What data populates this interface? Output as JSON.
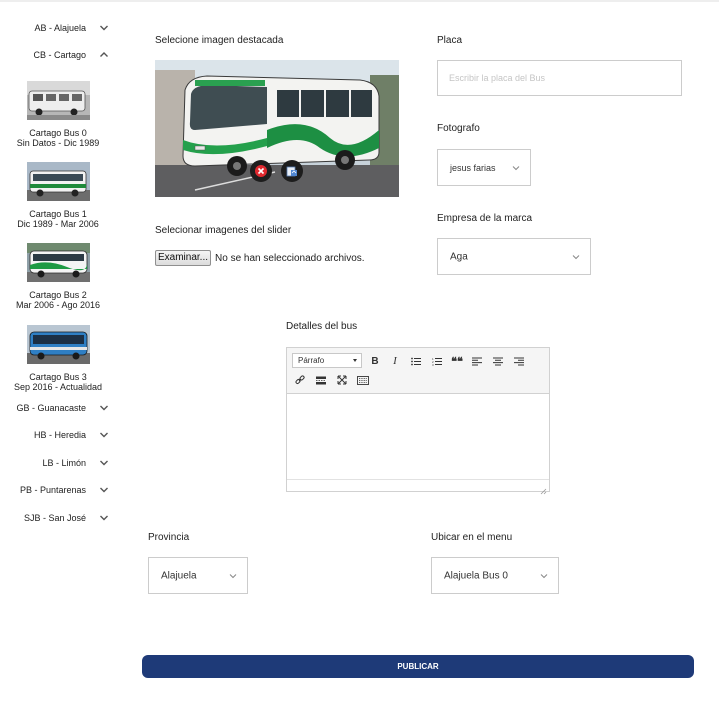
{
  "sidebar": {
    "provinces": [
      {
        "label": "AB - Alajuela",
        "expanded": false
      },
      {
        "label": "CB - Cartago",
        "expanded": true
      },
      {
        "label": "GB - Guanacaste",
        "expanded": false
      },
      {
        "label": "HB - Heredia",
        "expanded": false
      },
      {
        "label": "LB - Limón",
        "expanded": false
      },
      {
        "label": "PB - Puntarenas",
        "expanded": false
      },
      {
        "label": "SJB - San José",
        "expanded": false
      }
    ],
    "buses": [
      {
        "name": "Cartago Bus 0",
        "period": "Sin Datos - Dic 1989"
      },
      {
        "name": "Cartago Bus 1",
        "period": "Dic 1989 - Mar 2006"
      },
      {
        "name": "Cartago Bus 2",
        "period": "Mar 2006 - Ago 2016"
      },
      {
        "name": "Cartago Bus 3",
        "period": "Sep 2016 - Actualidad"
      }
    ]
  },
  "form": {
    "featured_image_label": "Selecione imagen destacada",
    "plate_label": "Placa",
    "plate_placeholder": "Escribir la placa del Bus",
    "plate_value": "",
    "photographer_label": "Fotografo",
    "photographer_value": "jesus farias",
    "slider_label": "Selecionar imagenes del slider",
    "file_button": "Examinar...",
    "file_status": "No se han seleccionado archivos.",
    "brand_label": "Empresa de la marca",
    "brand_value": "Aga",
    "details_label": "Detalles del bus",
    "editor": {
      "format_select": "Párrafo",
      "bold": "B",
      "italic": "I",
      "blockquote": "❝❝",
      "content": ""
    },
    "province_label": "Provincia",
    "province_value": "Alajuela",
    "menu_label": "Ubicar en el menu",
    "menu_value": "Alajuela Bus 0",
    "publish_button": "PUBLICAR"
  },
  "icons": {
    "chevron": "chevron-down-icon",
    "delete": "delete-icon",
    "replace": "replace-image-icon"
  },
  "colors": {
    "publish_bg": "#1e3a78",
    "delete_red": "#e0292f",
    "border": "#cccccc"
  }
}
